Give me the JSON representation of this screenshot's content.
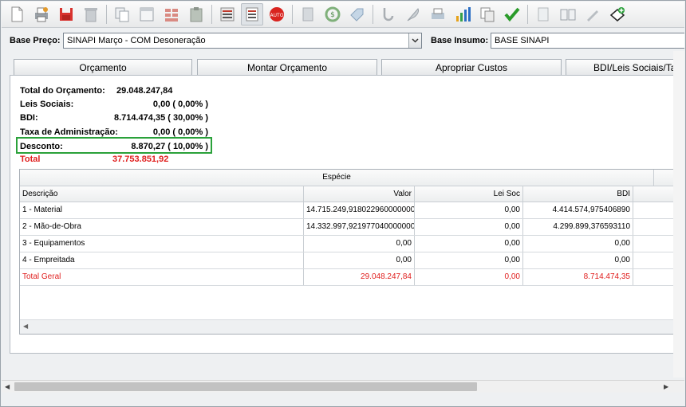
{
  "toolbar": {
    "icons": [
      "new-document-icon",
      "print-icon",
      "save-icon",
      "delete-icon",
      "copy-icon",
      "window-icon",
      "bricks-icon",
      "paste-icon",
      "list-icon",
      "checklist-icon",
      "auto-icon",
      "calculator-icon",
      "recycle-money-icon",
      "tag-icon",
      "hook-icon",
      "feather-icon",
      "printer-icon",
      "bar-chart-icon",
      "duplicate-icon",
      "check-icon",
      "notepad-icon",
      "book-icon",
      "pen-icon",
      "add-bookmark-icon"
    ],
    "auto_label": "AUTO"
  },
  "base": {
    "preco_label": "Base Preço:",
    "preco_value": "SINAPI Março - COM Desoneração",
    "insumo_label": "Base Insumo:",
    "insumo_value": "BASE SINAPI"
  },
  "tabs": [
    {
      "label": "Orçamento"
    },
    {
      "label": "Montar Orçamento"
    },
    {
      "label": "Apropriar Custos"
    },
    {
      "label": "BDI/Leis Sociais/Taxas"
    }
  ],
  "summary": {
    "total_orcamento_label": "Total do Orçamento:",
    "total_orcamento_value": "29.048.247,84",
    "leis_label": "Leis Sociais:",
    "leis_value": "0,00   ( 0,00% )",
    "bdi_label": "BDI:",
    "bdi_value": "8.714.474,35   ( 30,00% )",
    "taxa_label": "Taxa de Administração:",
    "taxa_value": "0,00   ( 0,00% )",
    "desconto_label": "Desconto:",
    "desconto_value": "8.870,27  ( 10,00% )",
    "total_label": "Total",
    "total_value": "37.753.851,92"
  },
  "grid": {
    "group_header": "Espécie",
    "columns": [
      "Descrição",
      "Valor",
      "Lei Soc",
      "BDI"
    ],
    "rows": [
      {
        "descricao": "1 - Material",
        "valor": "14.715.249,918022960000000",
        "leisoc": "0,00",
        "bdi": "4.414.574,975406890"
      },
      {
        "descricao": "2 - Mão-de-Obra",
        "valor": "14.332.997,921977040000000",
        "leisoc": "0,00",
        "bdi": "4.299.899,376593110"
      },
      {
        "descricao": "3 - Equipamentos",
        "valor": "0,00",
        "leisoc": "0,00",
        "bdi": "0,00"
      },
      {
        "descricao": "4 - Empreitada",
        "valor": "0,00",
        "leisoc": "0,00",
        "bdi": "0,00"
      }
    ],
    "total_row": {
      "descricao": "Total Geral",
      "valor": "29.048.247,84",
      "leisoc": "0,00",
      "bdi": "8.714.474,35"
    }
  },
  "colors": {
    "accent_red": "#e0201f",
    "highlight_green": "#2aa13a"
  }
}
